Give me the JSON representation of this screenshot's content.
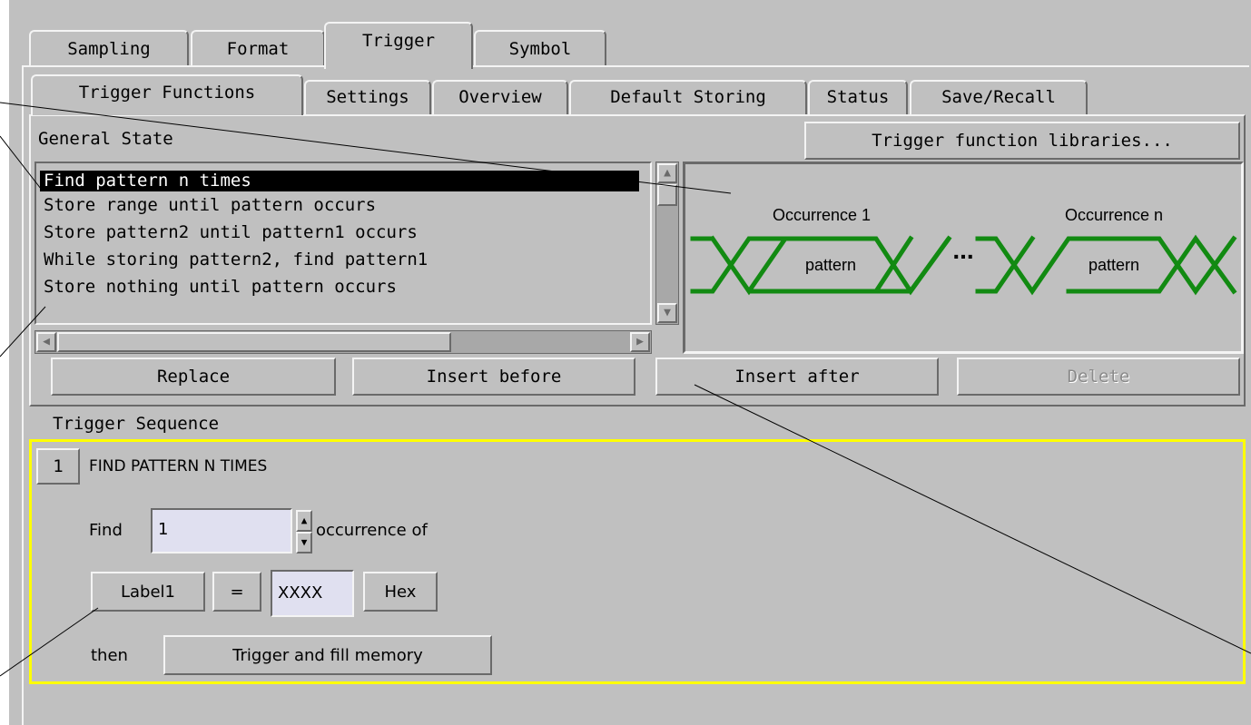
{
  "main_tabs": [
    {
      "label": "Sampling",
      "active": false
    },
    {
      "label": "Format",
      "active": false
    },
    {
      "label": "Trigger",
      "active": true
    },
    {
      "label": "Symbol",
      "active": false
    }
  ],
  "sub_tabs": [
    {
      "label": "Trigger Functions",
      "active": true
    },
    {
      "label": "Settings",
      "active": false
    },
    {
      "label": "Overview",
      "active": false
    },
    {
      "label": "Default Storing",
      "active": false
    },
    {
      "label": "Status",
      "active": false
    },
    {
      "label": "Save/Recall",
      "active": false
    }
  ],
  "functions": {
    "group_label": "General State",
    "libraries_button": "Trigger function libraries...",
    "list": [
      {
        "label": "Find pattern n times",
        "selected": true
      },
      {
        "label": "Store range until pattern occurs",
        "selected": false
      },
      {
        "label": "Store pattern2 until pattern1 occurs",
        "selected": false
      },
      {
        "label": "While storing pattern2, find pattern1",
        "selected": false
      },
      {
        "label": "Store nothing until pattern occurs",
        "selected": false
      }
    ],
    "preview": {
      "occurrence_first": "Occurrence 1",
      "occurrence_last": "Occurrence n",
      "pattern_label": "pattern",
      "ellipsis": "...",
      "wave_color": "#128a12"
    },
    "buttons": {
      "replace": "Replace",
      "insert_before": "Insert before",
      "insert_after": "Insert after",
      "delete": "Delete",
      "delete_enabled": false
    }
  },
  "sequence": {
    "title": "Trigger Sequence",
    "highlight_color": "#ffff00",
    "step_number": "1",
    "step_title": "FIND PATTERN N TIMES",
    "find_label": "Find",
    "count_value": "1",
    "occurrence_label": "occurrence of",
    "label_button": "Label1",
    "operator_button": "=",
    "pattern_value": "XXXX",
    "base_button": "Hex",
    "then_label": "then",
    "action_button": "Trigger and fill memory"
  }
}
